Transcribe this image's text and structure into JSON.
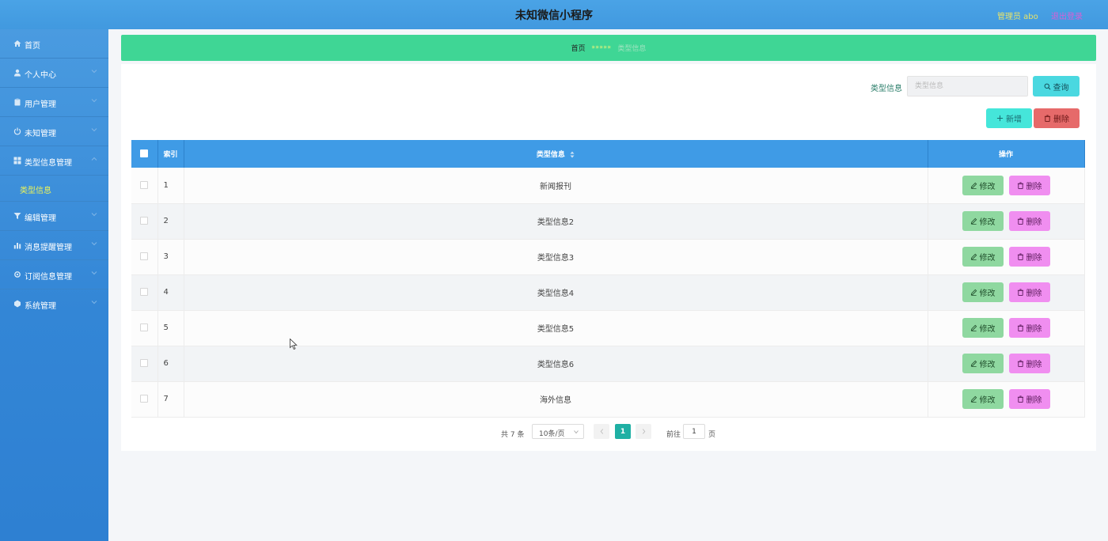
{
  "header": {
    "title": "未知微信小程序",
    "admin_label": "管理员 abo",
    "logout_label": "退出登录"
  },
  "sidebar": {
    "items": [
      {
        "label": "首页",
        "icon": "home-icon"
      },
      {
        "label": "个人中心",
        "icon": "user-icon"
      },
      {
        "label": "用户管理",
        "icon": "clipboard-icon"
      },
      {
        "label": "未知管理",
        "icon": "power-icon"
      },
      {
        "label": "类型信息管理",
        "icon": "grid-icon"
      },
      {
        "label": "编辑管理",
        "icon": "filter-icon"
      },
      {
        "label": "消息提醒管理",
        "icon": "bar-chart-icon"
      },
      {
        "label": "订阅信息管理",
        "icon": "gear-icon"
      },
      {
        "label": "系统管理",
        "icon": "settings-icon"
      }
    ],
    "submenu": {
      "label": "类型信息"
    }
  },
  "breadcrumb": {
    "home": "首页",
    "separator": "*****",
    "current": "类型信息"
  },
  "search": {
    "label": "类型信息",
    "placeholder": "类型信息",
    "query_button": "查询"
  },
  "actions": {
    "add_label": "新增",
    "delete_label": "删除"
  },
  "table": {
    "headers": {
      "index": "索引",
      "type": "类型信息",
      "ops": "操作"
    },
    "rows": [
      {
        "index": "1",
        "type": "新闻报刊"
      },
      {
        "index": "2",
        "type": "类型信息2"
      },
      {
        "index": "3",
        "type": "类型信息3"
      },
      {
        "index": "4",
        "type": "类型信息4"
      },
      {
        "index": "5",
        "type": "类型信息5"
      },
      {
        "index": "6",
        "type": "类型信息6"
      },
      {
        "index": "7",
        "type": "海外信息"
      }
    ],
    "edit_label": "修改",
    "delete_label": "删除"
  },
  "pagination": {
    "total": "共 7 条",
    "page_size": "10条/页",
    "current_page": "1",
    "goto_label": "前往",
    "goto_value": "1",
    "page_unit": "页"
  },
  "colors": {
    "topbar": "#4aa3e6",
    "sidebar": "#3386d6",
    "breadcrumb": "#3fd695",
    "table_header": "#3f9be6",
    "edit_button": "#8fd8a0",
    "delete_button": "#f08ef0",
    "current_page": "#1fb0a4"
  }
}
